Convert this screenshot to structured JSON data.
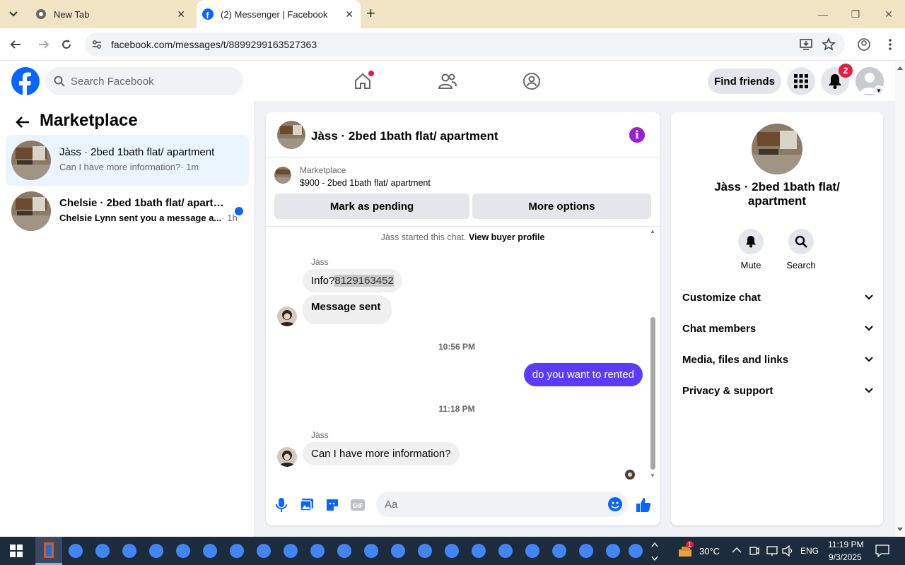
{
  "browser": {
    "tabs": [
      {
        "title": "New Tab",
        "active": false
      },
      {
        "title": "(2) Messenger | Facebook",
        "active": true
      }
    ],
    "url": "facebook.com/messages/t/8899299163527363"
  },
  "fb_header": {
    "search_placeholder": "Search Facebook",
    "find_friends_label": "Find friends",
    "notification_count": "2"
  },
  "left_pane": {
    "title": "Marketplace",
    "conversations": [
      {
        "title": "Jàss · 2bed 1bath flat/ apartment",
        "preview": "Can I have more information?",
        "time": " · 1m",
        "unread": false
      },
      {
        "title": "Chelsie · 2bed 1bath flat/ apartm...",
        "preview": "Chelsie Lynn sent you a message a...",
        "time": " · 1h",
        "unread": true
      }
    ]
  },
  "chat": {
    "title": "Jàss · 2bed 1bath flat/ apartment",
    "listing_label": "Marketplace",
    "listing_title": "$900 - 2bed 1bath flat/ apartment",
    "mark_pending_label": "Mark as pending",
    "more_options_label": "More options",
    "started_text": "Jàss started this chat.",
    "view_buyer_label": "View buyer profile",
    "messages": [
      {
        "sender": "Jàss",
        "text": "Info?",
        "highlight": "8129163452"
      },
      {
        "text": "Message sent"
      },
      {
        "time": "10:56 PM"
      },
      {
        "text": "do  you want to rented",
        "mine": true
      },
      {
        "time": "11:18 PM"
      },
      {
        "sender": "Jàss",
        "text": "Can I have more information?"
      }
    ],
    "composer_placeholder": "Aa"
  },
  "info_pane": {
    "name": "Jàss · 2bed 1bath flat/ apartment",
    "mute_label": "Mute",
    "search_label": "Search",
    "sections": [
      "Customize chat",
      "Chat members",
      "Media, files and links",
      "Privacy & support"
    ]
  },
  "taskbar": {
    "temperature": "30°C",
    "language": "ENG",
    "time": "11:19 PM",
    "date": "9/3/2025",
    "weather_badge": "1"
  },
  "colors": {
    "fb_blue": "#0866ff",
    "my_bubble": "#5b3bff",
    "info_purple": "#9b1fd6"
  }
}
